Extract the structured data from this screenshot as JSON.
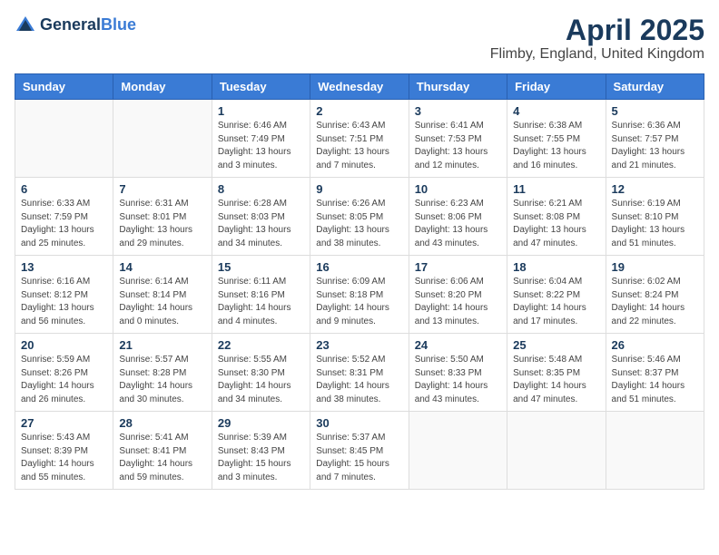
{
  "header": {
    "logo_general": "General",
    "logo_blue": "Blue",
    "title": "April 2025",
    "subtitle": "Flimby, England, United Kingdom"
  },
  "weekdays": [
    "Sunday",
    "Monday",
    "Tuesday",
    "Wednesday",
    "Thursday",
    "Friday",
    "Saturday"
  ],
  "weeks": [
    [
      {
        "day": "",
        "info": ""
      },
      {
        "day": "",
        "info": ""
      },
      {
        "day": "1",
        "info": "Sunrise: 6:46 AM\nSunset: 7:49 PM\nDaylight: 13 hours\nand 3 minutes."
      },
      {
        "day": "2",
        "info": "Sunrise: 6:43 AM\nSunset: 7:51 PM\nDaylight: 13 hours\nand 7 minutes."
      },
      {
        "day": "3",
        "info": "Sunrise: 6:41 AM\nSunset: 7:53 PM\nDaylight: 13 hours\nand 12 minutes."
      },
      {
        "day": "4",
        "info": "Sunrise: 6:38 AM\nSunset: 7:55 PM\nDaylight: 13 hours\nand 16 minutes."
      },
      {
        "day": "5",
        "info": "Sunrise: 6:36 AM\nSunset: 7:57 PM\nDaylight: 13 hours\nand 21 minutes."
      }
    ],
    [
      {
        "day": "6",
        "info": "Sunrise: 6:33 AM\nSunset: 7:59 PM\nDaylight: 13 hours\nand 25 minutes."
      },
      {
        "day": "7",
        "info": "Sunrise: 6:31 AM\nSunset: 8:01 PM\nDaylight: 13 hours\nand 29 minutes."
      },
      {
        "day": "8",
        "info": "Sunrise: 6:28 AM\nSunset: 8:03 PM\nDaylight: 13 hours\nand 34 minutes."
      },
      {
        "day": "9",
        "info": "Sunrise: 6:26 AM\nSunset: 8:05 PM\nDaylight: 13 hours\nand 38 minutes."
      },
      {
        "day": "10",
        "info": "Sunrise: 6:23 AM\nSunset: 8:06 PM\nDaylight: 13 hours\nand 43 minutes."
      },
      {
        "day": "11",
        "info": "Sunrise: 6:21 AM\nSunset: 8:08 PM\nDaylight: 13 hours\nand 47 minutes."
      },
      {
        "day": "12",
        "info": "Sunrise: 6:19 AM\nSunset: 8:10 PM\nDaylight: 13 hours\nand 51 minutes."
      }
    ],
    [
      {
        "day": "13",
        "info": "Sunrise: 6:16 AM\nSunset: 8:12 PM\nDaylight: 13 hours\nand 56 minutes."
      },
      {
        "day": "14",
        "info": "Sunrise: 6:14 AM\nSunset: 8:14 PM\nDaylight: 14 hours\nand 0 minutes."
      },
      {
        "day": "15",
        "info": "Sunrise: 6:11 AM\nSunset: 8:16 PM\nDaylight: 14 hours\nand 4 minutes."
      },
      {
        "day": "16",
        "info": "Sunrise: 6:09 AM\nSunset: 8:18 PM\nDaylight: 14 hours\nand 9 minutes."
      },
      {
        "day": "17",
        "info": "Sunrise: 6:06 AM\nSunset: 8:20 PM\nDaylight: 14 hours\nand 13 minutes."
      },
      {
        "day": "18",
        "info": "Sunrise: 6:04 AM\nSunset: 8:22 PM\nDaylight: 14 hours\nand 17 minutes."
      },
      {
        "day": "19",
        "info": "Sunrise: 6:02 AM\nSunset: 8:24 PM\nDaylight: 14 hours\nand 22 minutes."
      }
    ],
    [
      {
        "day": "20",
        "info": "Sunrise: 5:59 AM\nSunset: 8:26 PM\nDaylight: 14 hours\nand 26 minutes."
      },
      {
        "day": "21",
        "info": "Sunrise: 5:57 AM\nSunset: 8:28 PM\nDaylight: 14 hours\nand 30 minutes."
      },
      {
        "day": "22",
        "info": "Sunrise: 5:55 AM\nSunset: 8:30 PM\nDaylight: 14 hours\nand 34 minutes."
      },
      {
        "day": "23",
        "info": "Sunrise: 5:52 AM\nSunset: 8:31 PM\nDaylight: 14 hours\nand 38 minutes."
      },
      {
        "day": "24",
        "info": "Sunrise: 5:50 AM\nSunset: 8:33 PM\nDaylight: 14 hours\nand 43 minutes."
      },
      {
        "day": "25",
        "info": "Sunrise: 5:48 AM\nSunset: 8:35 PM\nDaylight: 14 hours\nand 47 minutes."
      },
      {
        "day": "26",
        "info": "Sunrise: 5:46 AM\nSunset: 8:37 PM\nDaylight: 14 hours\nand 51 minutes."
      }
    ],
    [
      {
        "day": "27",
        "info": "Sunrise: 5:43 AM\nSunset: 8:39 PM\nDaylight: 14 hours\nand 55 minutes."
      },
      {
        "day": "28",
        "info": "Sunrise: 5:41 AM\nSunset: 8:41 PM\nDaylight: 14 hours\nand 59 minutes."
      },
      {
        "day": "29",
        "info": "Sunrise: 5:39 AM\nSunset: 8:43 PM\nDaylight: 15 hours\nand 3 minutes."
      },
      {
        "day": "30",
        "info": "Sunrise: 5:37 AM\nSunset: 8:45 PM\nDaylight: 15 hours\nand 7 minutes."
      },
      {
        "day": "",
        "info": ""
      },
      {
        "day": "",
        "info": ""
      },
      {
        "day": "",
        "info": ""
      }
    ]
  ]
}
